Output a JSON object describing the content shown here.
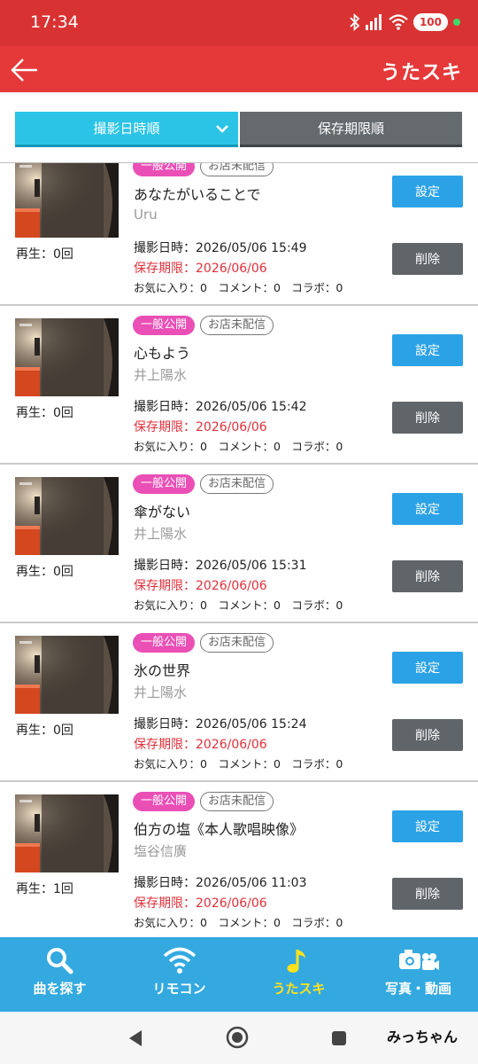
{
  "status_bar": {
    "time": "17:34",
    "battery": "100"
  },
  "header": {
    "logo": "うたスキ"
  },
  "sort_tabs": [
    {
      "label": "撮影日時順",
      "active": true
    },
    {
      "label": "保存期限順",
      "active": false
    }
  ],
  "items": [
    {
      "visibility": "一般公開",
      "shop_status": "お店未配信",
      "song": "あなたがいることで",
      "artist": "Uru",
      "plays": "再生：0回",
      "shot_at": "撮影日時：2026/05/06 15:49",
      "expires": "保存期限：2026/06/06",
      "stats": "お気に入り：0　コメント：0　コラボ：0",
      "settings_label": "設定",
      "delete_label": "削除"
    },
    {
      "visibility": "一般公開",
      "shop_status": "お店未配信",
      "song": "心もよう",
      "artist": "井上陽水",
      "plays": "再生：0回",
      "shot_at": "撮影日時：2026/05/06 15:42",
      "expires": "保存期限：2026/06/06",
      "stats": "お気に入り：0　コメント：0　コラボ：0",
      "settings_label": "設定",
      "delete_label": "削除"
    },
    {
      "visibility": "一般公開",
      "shop_status": "お店未配信",
      "song": "傘がない",
      "artist": "井上陽水",
      "plays": "再生：0回",
      "shot_at": "撮影日時：2026/05/06 15:31",
      "expires": "保存期限：2026/06/06",
      "stats": "お気に入り：0　コメント：0　コラボ：0",
      "settings_label": "設定",
      "delete_label": "削除"
    },
    {
      "visibility": "一般公開",
      "shop_status": "お店未配信",
      "song": "氷の世界",
      "artist": "井上陽水",
      "plays": "再生：0回",
      "shot_at": "撮影日時：2026/05/06 15:24",
      "expires": "保存期限：2026/06/06",
      "stats": "お気に入り：0　コメント：0　コラボ：0",
      "settings_label": "設定",
      "delete_label": "削除"
    },
    {
      "visibility": "一般公開",
      "shop_status": "お店未配信",
      "song": "伯方の塩《本人歌唱映像》",
      "artist": "塩谷信廣",
      "plays": "再生：1回",
      "shot_at": "撮影日時：2026/05/06 11:03",
      "expires": "保存期限：2026/06/06",
      "stats": "お気に入り：0　コメント：0　コラボ：0",
      "settings_label": "設定",
      "delete_label": "削除"
    }
  ],
  "bottom_nav": [
    {
      "label": "曲を探す",
      "icon": "search-icon",
      "active": false
    },
    {
      "label": "リモコン",
      "icon": "wifi-remote-icon",
      "active": false
    },
    {
      "label": "うたスキ",
      "icon": "music-note-icon",
      "active": true
    },
    {
      "label": "写真・動画",
      "icon": "camera-icon",
      "active": false
    }
  ],
  "system_nav": {
    "user_label": "みっちゃん"
  },
  "colors": {
    "header_red": "#e53939",
    "tab_cyan": "#2bc4e6",
    "nav_blue": "#33a9e0",
    "public_pink": "#ea4fb6",
    "expire_red": "#e0303a",
    "active_yellow": "#ffe21b"
  }
}
